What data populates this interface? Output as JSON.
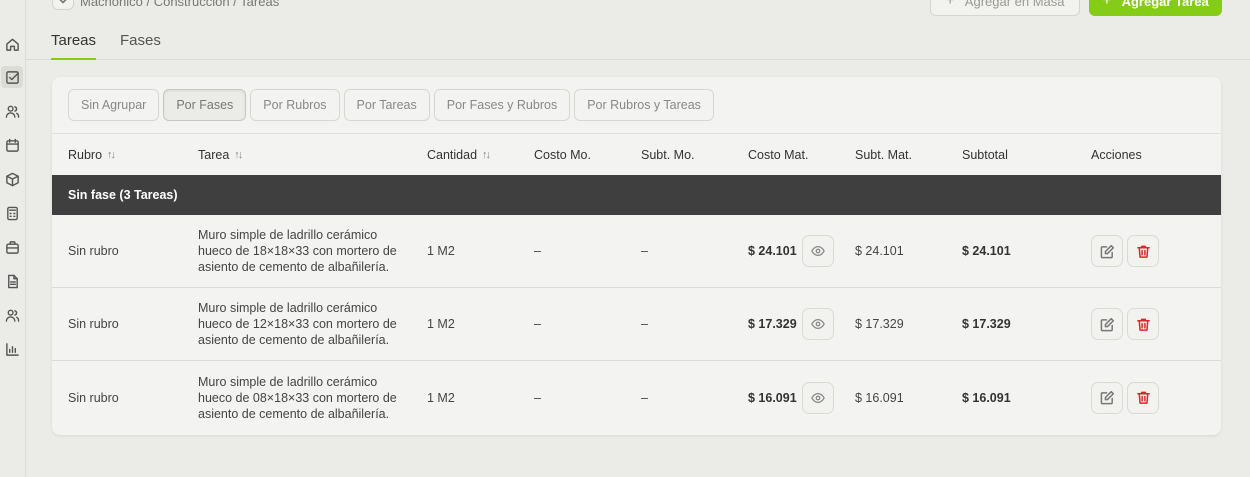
{
  "breadcrumb": "Machónico / Construcción / Tareas",
  "header": {
    "bulk_add_label": "Agregar en Masa",
    "add_task_label": "Agregar Tarea"
  },
  "tabs": [
    {
      "label": "Tareas",
      "active": true
    },
    {
      "label": "Fases",
      "active": false
    }
  ],
  "grouping": [
    {
      "label": "Sin Agrupar",
      "active": false
    },
    {
      "label": "Por Fases",
      "active": true
    },
    {
      "label": "Por Rubros",
      "active": false
    },
    {
      "label": "Por Tareas",
      "active": false
    },
    {
      "label": "Por Fases y Rubros",
      "active": false
    },
    {
      "label": "Por Rubros y Tareas",
      "active": false
    }
  ],
  "table": {
    "columns": [
      "Rubro",
      "Tarea",
      "Cantidad",
      "Costo Mo.",
      "Subt. Mo.",
      "Costo Mat.",
      "Subt. Mat.",
      "Subtotal",
      "Acciones"
    ],
    "phase_label": "Sin fase (3 Tareas)",
    "rows": [
      {
        "rubro": "Sin rubro",
        "tarea": "Muro simple de ladrillo cerámico hueco de 18×18×33 con mortero de asiento de cemento de albañilería.",
        "cantidad": "1 M2",
        "costo_mo": "–",
        "subt_mo": "–",
        "costo_mat": "$ 24.101",
        "subt_mat": "$ 24.101",
        "subtotal": "$ 24.101"
      },
      {
        "rubro": "Sin rubro",
        "tarea": "Muro simple de ladrillo cerámico hueco de 12×18×33 con mortero de asiento de cemento de albañilería.",
        "cantidad": "1 M2",
        "costo_mo": "–",
        "subt_mo": "–",
        "costo_mat": "$ 17.329",
        "subt_mat": "$ 17.329",
        "subtotal": "$ 17.329"
      },
      {
        "rubro": "Sin rubro",
        "tarea": "Muro simple de ladrillo cerámico hueco de 08×18×33 con mortero de asiento de cemento de albañilería.",
        "cantidad": "1 M2",
        "costo_mo": "–",
        "subt_mo": "–",
        "costo_mat": "$ 16.091",
        "subt_mat": "$ 16.091",
        "subtotal": "$ 16.091"
      }
    ]
  },
  "colors": {
    "accent": "#84cc16",
    "phase_bg": "#3f3f3f",
    "delete": "#e02424"
  },
  "icons": {
    "sidebar": [
      "home-icon",
      "tasks-icon",
      "users-icon",
      "calendar-icon",
      "box-icon",
      "calculator-icon",
      "briefcase-icon",
      "document-icon",
      "contacts-icon",
      "chart-icon"
    ],
    "row_actions": [
      "eye-icon",
      "edit-icon",
      "trash-icon"
    ]
  }
}
